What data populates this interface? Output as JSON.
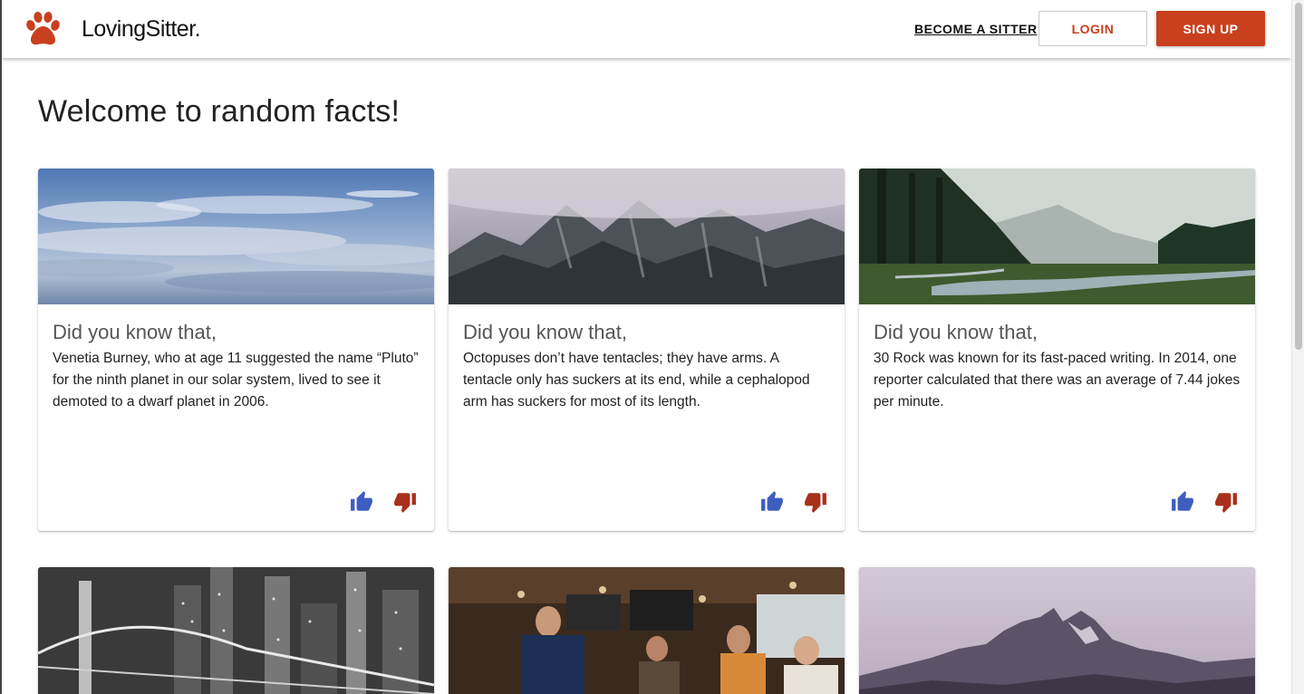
{
  "header": {
    "brand_name": "LovingSitter.",
    "become_sitter_label": "BECOME A SITTER",
    "login_label": "LOGIN",
    "signup_label": "SIGN UP"
  },
  "page": {
    "title": "Welcome to random facts!"
  },
  "cards": [
    {
      "image": "sky-clouds",
      "title": "Did you know that,",
      "text": "Venetia Burney, who at age 11 suggested the name “Pluto” for the ninth planet in our solar system, lived to see it demoted to a dwarf planet in 2006."
    },
    {
      "image": "misty-mountains",
      "title": "Did you know that,",
      "text": "Octopuses don’t have tentacles; they have arms. A tentacle only has suckers at its end, while a cephalopod arm has suckers for most of its length."
    },
    {
      "image": "forest-river",
      "title": "Did you know that,",
      "text": "30 Rock was known for its fast-paced writing. In 2014, one reporter calculated that there was an average of 7.44 jokes per minute."
    },
    {
      "image": "city-bridge-night"
    },
    {
      "image": "busy-bar"
    },
    {
      "image": "rocky-peaks"
    }
  ],
  "icons": {
    "thumbs_up": "thumbs-up-icon",
    "thumbs_down": "thumbs-down-icon",
    "paw": "paw-icon"
  },
  "colors": {
    "brand": "#c8401d",
    "thumbs_up": "#3f5dbf",
    "thumbs_down": "#a8301a"
  }
}
